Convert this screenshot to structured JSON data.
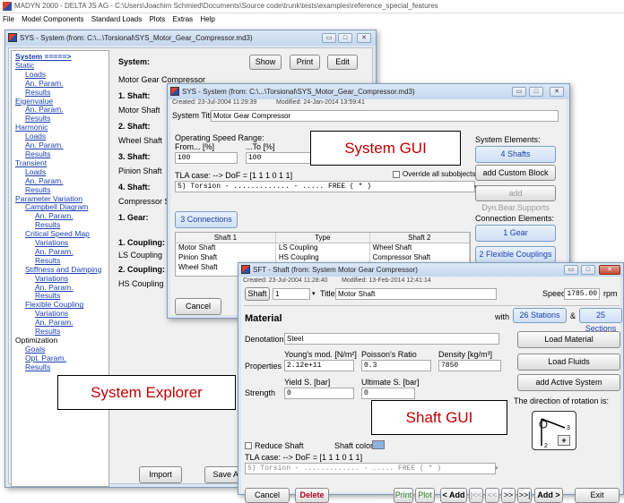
{
  "app": {
    "title": "MADYN 2000 - DELTA JS AG - C:\\Users\\Joachim Schmied\\Documents\\Source code\\trunk\\tests\\examples\\reference_special_features",
    "menu": [
      "File",
      "Model Components",
      "Standard Loads",
      "Plots",
      "Extras",
      "Help"
    ]
  },
  "sys_window": {
    "title": "SYS - System (from: C:\\...\\Torsional\\SYS_Motor_Gear_Compressor.md3)",
    "tree": [
      {
        "label": "System =====>",
        "level": 0,
        "style": "bold"
      },
      {
        "label": "Static",
        "level": 0,
        "style": "link"
      },
      {
        "label": "Loads",
        "level": 1,
        "style": "sub"
      },
      {
        "label": "An. Param.",
        "level": 1,
        "style": "sub"
      },
      {
        "label": "Results",
        "level": 1,
        "style": "sub"
      },
      {
        "label": "Eigenvalue",
        "level": 0,
        "style": "link"
      },
      {
        "label": "An. Param.",
        "level": 1,
        "style": "sub"
      },
      {
        "label": "Results",
        "level": 1,
        "style": "sub"
      },
      {
        "label": "Harmonic",
        "level": 0,
        "style": "link"
      },
      {
        "label": "Loads",
        "level": 1,
        "style": "sub"
      },
      {
        "label": "An. Param.",
        "level": 1,
        "style": "sub"
      },
      {
        "label": "Results",
        "level": 1,
        "style": "sub"
      },
      {
        "label": "Transient",
        "level": 0,
        "style": "link"
      },
      {
        "label": "Loads",
        "level": 1,
        "style": "sub"
      },
      {
        "label": "An. Param.",
        "level": 1,
        "style": "sub"
      },
      {
        "label": "Results",
        "level": 1,
        "style": "sub"
      },
      {
        "label": "Parameter Variation",
        "level": 0,
        "style": "link"
      },
      {
        "label": "Campbell Diagram",
        "level": 1,
        "style": "link"
      },
      {
        "label": "An. Param.",
        "level": 2,
        "style": "sub"
      },
      {
        "label": "Results",
        "level": 2,
        "style": "sub"
      },
      {
        "label": "Critical Speed Map",
        "level": 1,
        "style": "link"
      },
      {
        "label": "Variations",
        "level": 2,
        "style": "sub"
      },
      {
        "label": "An. Param.",
        "level": 2,
        "style": "sub"
      },
      {
        "label": "Results",
        "level": 2,
        "style": "sub"
      },
      {
        "label": "Stiffness and Damping",
        "level": 1,
        "style": "link"
      },
      {
        "label": "Variations",
        "level": 2,
        "style": "sub"
      },
      {
        "label": "An. Param.",
        "level": 2,
        "style": "sub"
      },
      {
        "label": "Results",
        "level": 2,
        "style": "sub"
      },
      {
        "label": "Flexible Coupling",
        "level": 1,
        "style": "link"
      },
      {
        "label": "Variations",
        "level": 2,
        "style": "sub"
      },
      {
        "label": "An. Param.",
        "level": 2,
        "style": "sub"
      },
      {
        "label": "Results",
        "level": 2,
        "style": "sub"
      },
      {
        "label": "Optimization",
        "level": 0,
        "style": "plain"
      },
      {
        "label": "Goals",
        "level": 1,
        "style": "sub"
      },
      {
        "label": "Opt. Param.",
        "level": 1,
        "style": "sub"
      },
      {
        "label": "Results",
        "level": 1,
        "style": "sub"
      }
    ],
    "system_label": "System:",
    "system_value": "Motor Gear Compressor",
    "show": "Show",
    "print": "Print",
    "edit": "Edit",
    "items": [
      {
        "label": "1. Shaft:",
        "value": "Motor Shaft"
      },
      {
        "label": "2. Shaft:",
        "value": "Wheel Shaft"
      },
      {
        "label": "3. Shaft:",
        "value": "Pinion Shaft"
      },
      {
        "label": "4. Shaft:",
        "value": "Compressor Sh"
      },
      {
        "label": "1. Gear:",
        "value": ""
      },
      {
        "label": "1. Coupling:",
        "value": "LS Coupling"
      },
      {
        "label": "2. Coupling:",
        "value": "HS Coupling"
      }
    ],
    "import": "Import",
    "save_as": "Save As"
  },
  "sys_gui": {
    "title": "SYS - System (from: C:\\...\\Torsional\\SYS_Motor_Gear_Compressor.md3)",
    "created": "Created: 23-Jul-2004 11:29:39",
    "modified": "Modified: 24-Jan-2014 13:59:41",
    "system_title_label": "System Title:",
    "system_title_value": "Motor Gear Compressor",
    "speed_range_label": "Operating Speed Range:",
    "from_label": "From... [%]",
    "to_label": "...To [%]",
    "from_value": "100",
    "to_value": "100",
    "tla_case": "TLA case: --> DoF = [1 1 1 0 1 1]",
    "override": "Override all subobjects",
    "tla_value": "5) Torsion  -  .............  -  .....   FREE  ( * )",
    "system_elements": "System Elements:",
    "four_shafts": "4 Shafts",
    "add_custom_block": "add Custom Block",
    "add_dyn_bear": "add Dyn.Bear.Supports",
    "three_connections": "3 Connections",
    "table_headers": [
      "Shaft 1",
      "Type",
      "Shaft 2"
    ],
    "table_rows": [
      [
        "Motor Shaft",
        "LS Coupling",
        "Wheel Shaft"
      ],
      [
        "Pinion Shaft",
        "HS Coupling",
        "Compressor Shaft"
      ],
      [
        "Wheel Shaft",
        "",
        ""
      ]
    ],
    "connection_elements": "Connection Elements:",
    "one_gear": "1 Gear",
    "two_flex": "2 Flexible Couplings",
    "cancel": "Cancel"
  },
  "sft_gui": {
    "title": "SFT - Shaft (from: System Motor Gear Compressor)",
    "created": "Created: 23-Jul-2004 11:28:40",
    "modified": "Modified: 13-Feb-2014 12:41:14",
    "shaft_btn": "Shaft",
    "shaft_num": "1",
    "title_label": "Title",
    "title_value": "Motor Shaft",
    "speed_label": "Speed",
    "speed_value": "1785.00",
    "speed_unit": "rpm",
    "material": "Material",
    "with": "with",
    "stations": "26 Stations",
    "amp": "&",
    "sections": "25 Sections",
    "denotation_label": "Denotation",
    "denotation_value": "Steel",
    "load_material": "Load Material",
    "properties": "Properties",
    "youngs_label": "Young's mod. [N/m²]",
    "youngs_value": "2.12e+11",
    "poisson_label": "Poisson's Ratio",
    "poisson_value": "0.3",
    "density_label": "Density [kg/m³]",
    "density_value": "7850",
    "load_fluids": "Load Fluids",
    "strength": "Strength",
    "yield_label": "Yield S. [bar]",
    "yield_value": "0",
    "ultimate_label": "Ultimate S. [bar]",
    "ultimate_value": "0",
    "add_active_system": "add Active System",
    "rotation_text": "The direction of rotation is:",
    "reduce_shaft": "Reduce Shaft",
    "shaft_color": "Shaft color",
    "tla_case": "TLA case: --> DoF = [1 1 1 0 1 1]",
    "tla_value": "5) Torsion  -  .............  -  .....   FREE  ( * )",
    "cancel": "Cancel",
    "delete": "Delete",
    "print": "Print",
    "plot": "Plot",
    "add_prev": "< Add",
    "nav": [
      "|<<",
      "<<",
      ">>",
      ">>|"
    ],
    "add_next": "Add >",
    "exit": "Exit",
    "axis_labels": [
      "3",
      "2"
    ]
  },
  "callouts": {
    "system_gui": "System GUI",
    "system_explorer": "System Explorer",
    "shaft_gui": "Shaft GUI"
  },
  "colors": {
    "callout_text": "#c00000",
    "link": "#1a3fb0",
    "shaft_color": "#8fb1e0"
  }
}
